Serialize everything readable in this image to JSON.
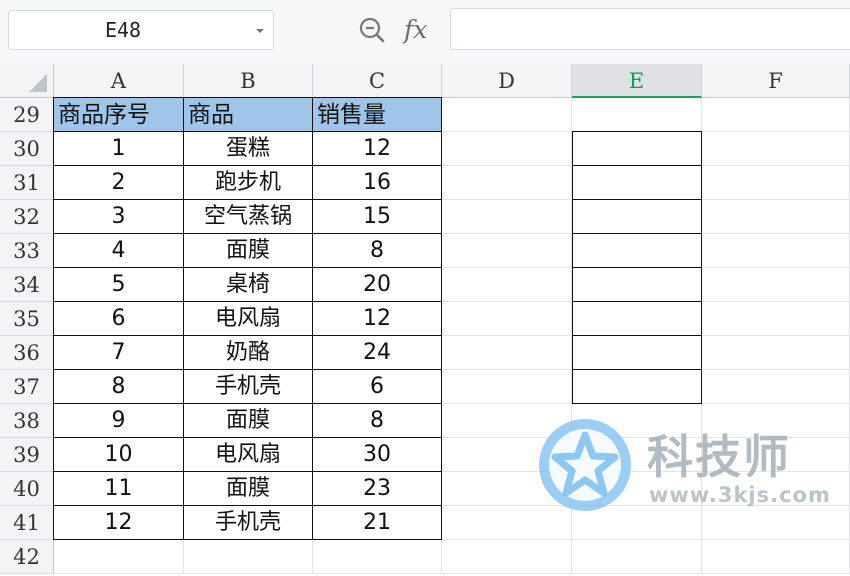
{
  "formula_bar": {
    "name_box_value": "E48",
    "fx_label": "fx",
    "formula_value": ""
  },
  "columns": [
    "A",
    "B",
    "C",
    "D",
    "E",
    "F"
  ],
  "selected_column": "E",
  "rows": [
    "29",
    "30",
    "31",
    "32",
    "33",
    "34",
    "35",
    "36",
    "37",
    "38",
    "39",
    "40",
    "41",
    "42"
  ],
  "table": {
    "headers": [
      "商品序号",
      "商品",
      "销售量"
    ],
    "data": [
      [
        "1",
        "蛋糕",
        "12"
      ],
      [
        "2",
        "跑步机",
        "16"
      ],
      [
        "3",
        "空气蒸锅",
        "15"
      ],
      [
        "4",
        "面膜",
        "8"
      ],
      [
        "5",
        "桌椅",
        "20"
      ],
      [
        "6",
        "电风扇",
        "12"
      ],
      [
        "7",
        "奶酪",
        "24"
      ],
      [
        "8",
        "手机壳",
        "6"
      ],
      [
        "9",
        "面膜",
        "8"
      ],
      [
        "10",
        "电风扇",
        "30"
      ],
      [
        "11",
        "面膜",
        "23"
      ],
      [
        "12",
        "手机壳",
        "21"
      ]
    ]
  },
  "watermark": {
    "title": "科技师",
    "url": "www.3kjs.com"
  },
  "colors": {
    "header_fill": "#9fc5ea",
    "selected_column_accent": "#1aa260"
  }
}
